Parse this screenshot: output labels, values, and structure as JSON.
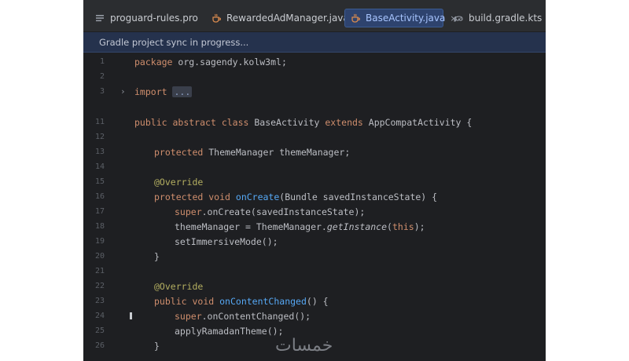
{
  "tabs": [
    {
      "label": "proguard-rules.pro",
      "icon": "list-file-icon"
    },
    {
      "label": "RewardedAdManager.java",
      "icon": "java-file-icon"
    },
    {
      "label": "BaseActivity.java",
      "icon": "java-file-icon",
      "active": true,
      "close": "×"
    },
    {
      "label": "build.gradle.kts",
      "icon": "gradle-file-icon"
    }
  ],
  "banner": {
    "text": "Gradle project sync in progress..."
  },
  "editor": {
    "line_numbers": [
      "1",
      "2",
      "3",
      "11",
      "12",
      "13",
      "14",
      "15",
      "16",
      "17",
      "18",
      "19",
      "20",
      "21",
      "22",
      "23",
      "24",
      "25",
      "26"
    ],
    "fold_marker": "›",
    "import_fold": "...",
    "tokens": {
      "package": "package",
      "package_name": " org.sagendy.kolw3ml;",
      "import": "import",
      "public": "public",
      "abstract": "abstract",
      "class": "class",
      "class_name": " BaseActivity ",
      "extends": "extends",
      "super_class": " AppCompatActivity {",
      "protected": "protected",
      "field": " ThemeManager themeManager;",
      "override": "@Override",
      "void": "void",
      "oncreate": "onCreate",
      "oncreate_params": "(Bundle savedInstanceState) {",
      "super": "super",
      "super_oncreate": ".onCreate(savedInstanceState);",
      "assign_lhs": "themeManager = ThemeManager.",
      "getinstance": "getInstance",
      "paren_open": "(",
      "this": "this",
      "paren_close": ");",
      "immersive": "setImmersiveMode();",
      "close_brace": "}",
      "oncontentchanged": "onContentChanged",
      "occ_params": "() {",
      "super_occ": ".onContentChanged();",
      "apply_theme": "applyRamadanTheme();"
    }
  },
  "watermark": "خمسات"
}
